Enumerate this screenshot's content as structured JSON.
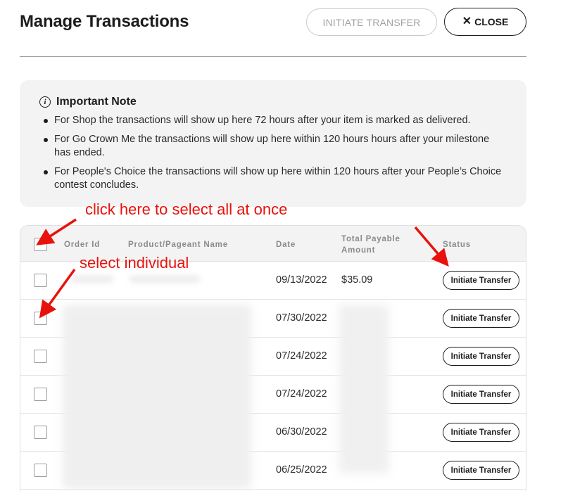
{
  "header": {
    "title": "Manage Transactions",
    "initiate_transfer_label": "INITIATE TRANSFER",
    "close_label": "CLOSE",
    "close_icon": "close-icon"
  },
  "note": {
    "icon": "info-icon",
    "title": "Important Note",
    "items": [
      "For Shop the transactions will show up here 72 hours after your item is marked as delivered.",
      "For Go Crown Me the transactions will show up here within 120 hours hours after your milestone has ended.",
      "For People's Choice the transactions will show up here within 120 hours after your People’s Choice contest concludes."
    ]
  },
  "table": {
    "columns": {
      "order_id": "Order Id",
      "product": "Product/Pageant Name",
      "date": "Date",
      "amount": "Total Payable Amount",
      "status": "Status"
    },
    "rows": [
      {
        "date": "09/13/2022",
        "amount": "$35.09",
        "action": "Initiate Transfer"
      },
      {
        "date": "07/30/2022",
        "amount": "",
        "action": "Initiate Transfer"
      },
      {
        "date": "07/24/2022",
        "amount": "",
        "action": "Initiate Transfer"
      },
      {
        "date": "07/24/2022",
        "amount": "",
        "action": "Initiate Transfer"
      },
      {
        "date": "06/30/2022",
        "amount": "",
        "action": "Initiate Transfer"
      },
      {
        "date": "06/25/2022",
        "amount": "",
        "action": "Initiate Transfer"
      }
    ]
  },
  "annotations": {
    "select_all": "click here to select all at once",
    "select_individual": "select individual",
    "color": "#e8120c"
  }
}
